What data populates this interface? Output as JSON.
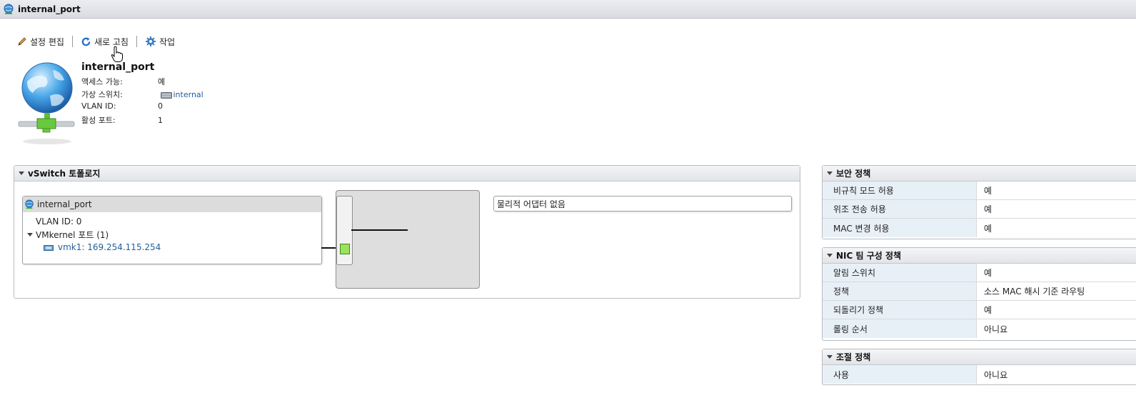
{
  "window": {
    "title": "internal_port",
    "icon": "portgroup-globe-icon"
  },
  "toolbar": {
    "edit_label": "설정 편집",
    "refresh_label": "새로 고침",
    "actions_label": "작업"
  },
  "summary": {
    "title": "internal_port",
    "rows": [
      {
        "key": "액세스 가능:",
        "value": "예"
      },
      {
        "key": "가상 스위치:",
        "value": "internal"
      },
      {
        "key": "VLAN ID:",
        "value": "0"
      },
      {
        "key": "활성 포트:",
        "value": "1"
      }
    ]
  },
  "topology": {
    "title": "vSwitch 토폴로지",
    "portgroup": {
      "name": "internal_port",
      "vlan": "VLAN ID: 0",
      "vmkernel_label": "VMkernel 포트 (1)",
      "vmk": "vmk1: 169.254.115.254"
    },
    "physical_adapters": "물리적 어댑터 없음"
  },
  "security_policy": {
    "title": "보안 정책",
    "rows": [
      {
        "key": "비규칙 모드 허용",
        "value": "예"
      },
      {
        "key": "위조 전송 허용",
        "value": "예"
      },
      {
        "key": "MAC 변경 허용",
        "value": "예"
      }
    ]
  },
  "nic_teaming": {
    "title": "NIC 팀 구성 정책",
    "rows": [
      {
        "key": "알림 스위치",
        "value": "예"
      },
      {
        "key": "정책",
        "value": "소스 MAC 해시 기준 라우팅"
      },
      {
        "key": "되돌리기 정책",
        "value": "예"
      },
      {
        "key": "롤링 순서",
        "value": "아니요"
      }
    ]
  },
  "shaping_policy": {
    "title": "조절 정책",
    "rows": [
      {
        "key": "사용",
        "value": "아니요"
      }
    ]
  },
  "colors": {
    "link": "#1f5f9a",
    "accent_green": "#7ccd3a",
    "header_bg": "#e2e4e8"
  }
}
